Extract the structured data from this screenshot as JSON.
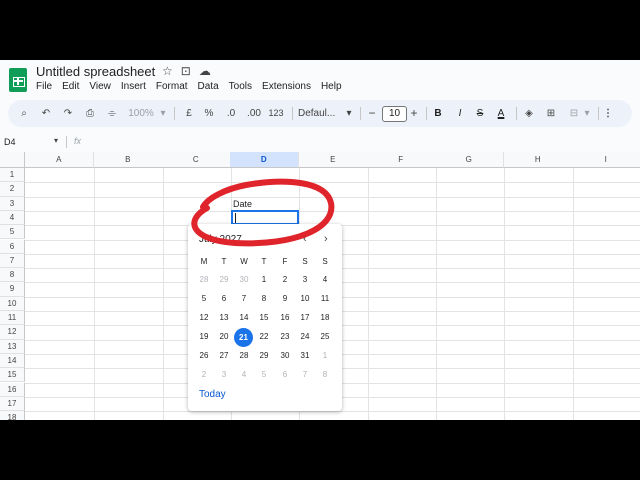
{
  "document": {
    "title": "Untitled spreadsheet"
  },
  "title_icons": [
    "star-icon",
    "move-icon",
    "cloud-status-icon"
  ],
  "menu": [
    "File",
    "Edit",
    "View",
    "Insert",
    "Format",
    "Data",
    "Tools",
    "Extensions",
    "Help"
  ],
  "toolbar": {
    "zoom": "100%",
    "currency": "£",
    "percent": "%",
    "decrease_decimal": ".0",
    "increase_decimal": ".00",
    "number_format": "123",
    "font": "Defaul...",
    "font_size": "10",
    "minus": "−",
    "plus": "+",
    "bold": "B",
    "italic": "I",
    "strikethrough": "S",
    "text_color": "A",
    "more": "⋮"
  },
  "formula_bar": {
    "name_box": "D4",
    "fx": "fx"
  },
  "columns": [
    "A",
    "B",
    "C",
    "D",
    "E",
    "F",
    "G",
    "H",
    "I"
  ],
  "selected_column": "D",
  "rows": [
    "1",
    "2",
    "3",
    "4",
    "5",
    "6",
    "7",
    "8",
    "9",
    "10",
    "11",
    "12",
    "13",
    "14",
    "15",
    "16",
    "17",
    "18"
  ],
  "cells": {
    "d3": "Date",
    "d4": ""
  },
  "date_picker": {
    "month_label": "July 2027",
    "prev": "‹",
    "next": "›",
    "weekdays": [
      "M",
      "T",
      "W",
      "T",
      "F",
      "S",
      "S"
    ],
    "weeks": [
      [
        "28",
        "29",
        "30",
        "1",
        "2",
        "3",
        "4"
      ],
      [
        "5",
        "6",
        "7",
        "8",
        "9",
        "10",
        "11"
      ],
      [
        "12",
        "13",
        "14",
        "15",
        "16",
        "17",
        "18"
      ],
      [
        "19",
        "20",
        "21",
        "22",
        "23",
        "24",
        "25"
      ],
      [
        "26",
        "27",
        "28",
        "29",
        "30",
        "31",
        "1"
      ],
      [
        "2",
        "3",
        "4",
        "5",
        "6",
        "7",
        "8"
      ]
    ],
    "selected_day": "21",
    "today_label": "Today"
  },
  "colors": {
    "accent": "#1a73e8",
    "annotation": "#e0242b",
    "sheets_green": "#0f9d58"
  }
}
